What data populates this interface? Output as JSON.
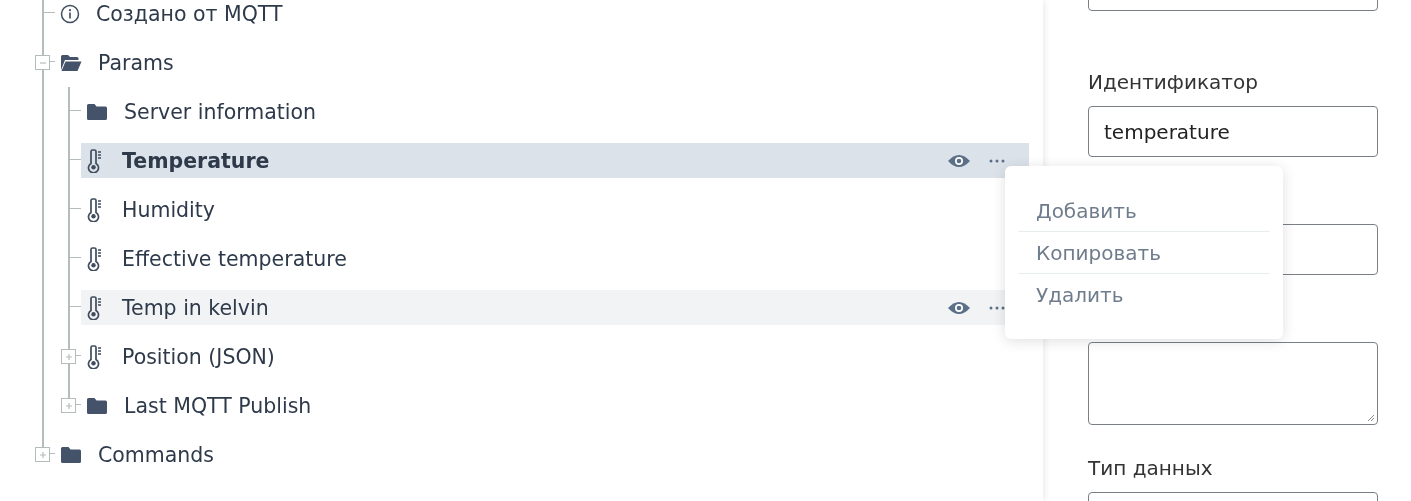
{
  "tree": {
    "items": [
      {
        "label": "Создано от MQTT",
        "kind": "info",
        "selected": false,
        "hovered": false
      },
      {
        "label": "Params",
        "kind": "folder",
        "expanded": true,
        "selected": false,
        "hovered": false,
        "children": [
          {
            "label": "Server information",
            "kind": "folder",
            "selected": false,
            "hovered": false
          },
          {
            "label": "Temperature",
            "kind": "thermometer",
            "selected": true,
            "hovered": false
          },
          {
            "label": "Humidity",
            "kind": "thermometer",
            "selected": false,
            "hovered": false
          },
          {
            "label": "Effective temperature",
            "kind": "thermometer",
            "selected": false,
            "hovered": false
          },
          {
            "label": "Temp in kelvin",
            "kind": "thermometer",
            "selected": false,
            "hovered": true
          },
          {
            "label": "Position (JSON)",
            "kind": "thermometer",
            "expanded": false,
            "selected": false,
            "hovered": false
          },
          {
            "label": "Last MQTT Publish",
            "kind": "folder",
            "expanded": false,
            "selected": false,
            "hovered": false
          }
        ]
      },
      {
        "label": "Commands",
        "kind": "folder",
        "expanded": false,
        "selected": false,
        "hovered": false
      }
    ]
  },
  "context_menu": {
    "items": [
      "Добавить",
      "Копировать",
      "Удалить"
    ]
  },
  "form": {
    "fields": [
      {
        "kind": "input"
      },
      {
        "kind": "input",
        "label": "Идентификатор",
        "value": "temperature"
      },
      {
        "kind": "input"
      },
      {
        "kind": "textarea"
      },
      {
        "kind": "input",
        "label": "Тип данных"
      }
    ]
  }
}
